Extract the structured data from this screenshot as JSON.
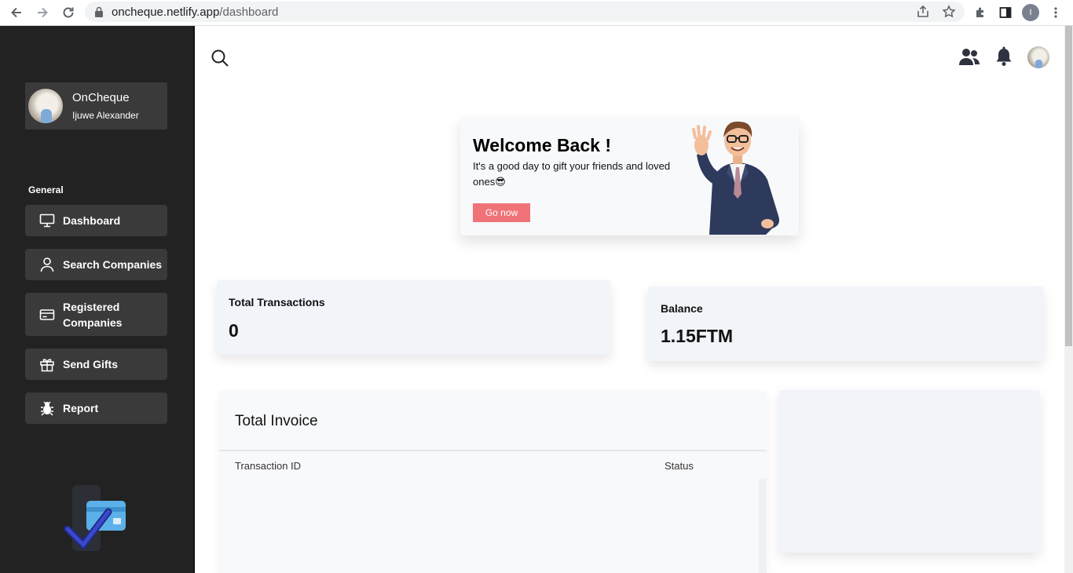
{
  "browser": {
    "url_host": "oncheque.netlify.app",
    "url_path": "/dashboard",
    "profile_initial": "I"
  },
  "sidebar": {
    "org_name": "OnCheque",
    "user_name": "Ijuwe Alexander",
    "section_label": "General",
    "items": [
      {
        "label": "Dashboard",
        "icon": "monitor-icon"
      },
      {
        "label": "Search Companies",
        "icon": "user-icon"
      },
      {
        "label": "Registered Companies",
        "icon": "card-icon"
      },
      {
        "label": "Send Gifts",
        "icon": "gift-icon"
      },
      {
        "label": "Report",
        "icon": "bug-icon"
      }
    ]
  },
  "topbar": {
    "icons": [
      "search-icon",
      "users-icon",
      "bell-icon",
      "avatar"
    ]
  },
  "welcome": {
    "title": "Welcome Back !",
    "text": "It's a good day to gift your friends and loved ones😎",
    "button_label": "Go now"
  },
  "stats": {
    "transactions_label": "Total Transactions",
    "transactions_value": "0",
    "balance_label": "Balance",
    "balance_value": "1.15FTM"
  },
  "invoice": {
    "title": "Total Invoice",
    "columns": [
      "Transaction ID",
      "Status"
    ]
  },
  "colors": {
    "sidebar_bg": "#222222",
    "menu_item_bg": "#3a3a3a",
    "accent_button": "#f07378",
    "card_bg": "#f1f4f9"
  }
}
